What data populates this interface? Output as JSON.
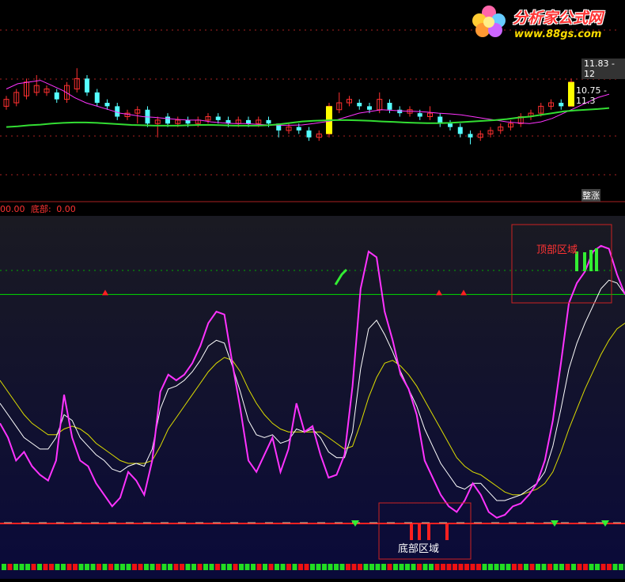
{
  "brand": {
    "name": "分析家公式网",
    "url": "www.88gs.com"
  },
  "price_panel": {
    "price_labels": [
      "11.83 - 12",
      "10.75 - 11.3"
    ],
    "tag": "整涨"
  },
  "status": {
    "left_value": "00.00",
    "bottom_label": "底部:",
    "bottom_value": "0.00"
  },
  "regions": {
    "top": "顶部区域",
    "bottom": "底部区域"
  },
  "colors": {
    "background": "#000000",
    "indicator_background": "#0a0a24",
    "up": "#ff3030",
    "down": "#55ffff",
    "ma_short": "#ff33ff",
    "ma_long": "#33dd33",
    "main_line": "#ff33ff",
    "white_line": "#ffffff",
    "yellow_line": "#dddd00",
    "threshold": "#00dd00",
    "bottom_line": "#ff2020",
    "highlight_bar": "#ffff00"
  },
  "chart_data": [
    {
      "type": "candlestick",
      "title": "",
      "candles": [
        {
          "o": 11.5,
          "c": 11.7,
          "h": 11.8,
          "l": 11.4,
          "up": true
        },
        {
          "o": 11.6,
          "c": 11.9,
          "h": 12.0,
          "l": 11.5,
          "up": true
        },
        {
          "o": 11.8,
          "c": 12.2,
          "h": 12.3,
          "l": 11.7,
          "up": true
        },
        {
          "o": 12.1,
          "c": 11.9,
          "h": 12.4,
          "l": 11.8,
          "up": true
        },
        {
          "o": 11.9,
          "c": 12.0,
          "h": 12.1,
          "l": 11.8,
          "up": true
        },
        {
          "o": 11.9,
          "c": 11.7,
          "h": 12.0,
          "l": 11.6,
          "up": false
        },
        {
          "o": 11.7,
          "c": 12.1,
          "h": 12.2,
          "l": 11.6,
          "up": true
        },
        {
          "o": 12.0,
          "c": 12.3,
          "h": 12.6,
          "l": 11.9,
          "up": true
        },
        {
          "o": 12.3,
          "c": 11.9,
          "h": 12.4,
          "l": 11.8,
          "up": false
        },
        {
          "o": 11.9,
          "c": 11.6,
          "h": 12.0,
          "l": 11.5,
          "up": false
        },
        {
          "o": 11.6,
          "c": 11.5,
          "h": 11.7,
          "l": 11.4,
          "up": false
        },
        {
          "o": 11.5,
          "c": 11.2,
          "h": 11.6,
          "l": 11.1,
          "up": false
        },
        {
          "o": 11.2,
          "c": 11.3,
          "h": 11.4,
          "l": 11.1,
          "up": true
        },
        {
          "o": 11.3,
          "c": 11.4,
          "h": 11.5,
          "l": 11.0,
          "up": true
        },
        {
          "o": 11.4,
          "c": 11.0,
          "h": 11.5,
          "l": 10.9,
          "up": false
        },
        {
          "o": 11.0,
          "c": 11.1,
          "h": 11.2,
          "l": 10.6,
          "up": true
        },
        {
          "o": 11.2,
          "c": 11.0,
          "h": 11.3,
          "l": 10.9,
          "up": false
        },
        {
          "o": 11.0,
          "c": 11.1,
          "h": 11.2,
          "l": 10.9,
          "up": true
        },
        {
          "o": 11.1,
          "c": 11.0,
          "h": 11.2,
          "l": 10.9,
          "up": false
        },
        {
          "o": 11.0,
          "c": 11.1,
          "h": 11.2,
          "l": 10.9,
          "up": true
        },
        {
          "o": 11.1,
          "c": 11.2,
          "h": 11.3,
          "l": 11.0,
          "up": true
        },
        {
          "o": 11.2,
          "c": 11.1,
          "h": 11.3,
          "l": 11.0,
          "up": false
        },
        {
          "o": 11.1,
          "c": 11.0,
          "h": 11.2,
          "l": 10.9,
          "up": false
        },
        {
          "o": 11.0,
          "c": 11.1,
          "h": 11.2,
          "l": 10.9,
          "up": true
        },
        {
          "o": 11.1,
          "c": 11.0,
          "h": 11.2,
          "l": 10.9,
          "up": false
        },
        {
          "o": 11.0,
          "c": 11.1,
          "h": 11.2,
          "l": 10.9,
          "up": true
        },
        {
          "o": 11.1,
          "c": 11.0,
          "h": 11.2,
          "l": 10.9,
          "up": false
        },
        {
          "o": 11.0,
          "c": 10.8,
          "h": 11.0,
          "l": 10.6,
          "up": false
        },
        {
          "o": 10.8,
          "c": 10.9,
          "h": 11.0,
          "l": 10.7,
          "up": true
        },
        {
          "o": 10.9,
          "c": 10.8,
          "h": 11.0,
          "l": 10.7,
          "up": false
        },
        {
          "o": 10.8,
          "c": 10.6,
          "h": 10.9,
          "l": 10.5,
          "up": false
        },
        {
          "o": 10.6,
          "c": 10.7,
          "h": 10.8,
          "l": 10.5,
          "up": true
        },
        {
          "o": 10.7,
          "c": 11.5,
          "h": 11.6,
          "l": 10.6,
          "up": true
        },
        {
          "o": 11.4,
          "c": 11.6,
          "h": 11.9,
          "l": 11.3,
          "up": true
        },
        {
          "o": 11.6,
          "c": 11.7,
          "h": 11.8,
          "l": 11.5,
          "up": true
        },
        {
          "o": 11.6,
          "c": 11.5,
          "h": 11.7,
          "l": 11.4,
          "up": false
        },
        {
          "o": 11.5,
          "c": 11.4,
          "h": 11.6,
          "l": 11.3,
          "up": false
        },
        {
          "o": 11.4,
          "c": 11.7,
          "h": 11.9,
          "l": 11.3,
          "up": true
        },
        {
          "o": 11.6,
          "c": 11.4,
          "h": 11.7,
          "l": 11.3,
          "up": false
        },
        {
          "o": 11.4,
          "c": 11.3,
          "h": 11.5,
          "l": 11.2,
          "up": false
        },
        {
          "o": 11.3,
          "c": 11.4,
          "h": 11.5,
          "l": 11.2,
          "up": true
        },
        {
          "o": 11.3,
          "c": 11.2,
          "h": 11.4,
          "l": 11.1,
          "up": false
        },
        {
          "o": 11.2,
          "c": 11.3,
          "h": 11.5,
          "l": 11.1,
          "up": true
        },
        {
          "o": 11.2,
          "c": 11.0,
          "h": 11.3,
          "l": 10.9,
          "up": false
        },
        {
          "o": 11.0,
          "c": 10.9,
          "h": 11.1,
          "l": 10.8,
          "up": false
        },
        {
          "o": 10.9,
          "c": 10.7,
          "h": 11.0,
          "l": 10.6,
          "up": false
        },
        {
          "o": 10.7,
          "c": 10.6,
          "h": 10.8,
          "l": 10.4,
          "up": false
        },
        {
          "o": 10.6,
          "c": 10.7,
          "h": 10.8,
          "l": 10.5,
          "up": true
        },
        {
          "o": 10.7,
          "c": 10.8,
          "h": 10.9,
          "l": 10.6,
          "up": true
        },
        {
          "o": 10.8,
          "c": 10.9,
          "h": 11.0,
          "l": 10.7,
          "up": true
        },
        {
          "o": 10.9,
          "c": 11.0,
          "h": 11.1,
          "l": 10.8,
          "up": true
        },
        {
          "o": 11.0,
          "c": 11.2,
          "h": 11.3,
          "l": 10.9,
          "up": true
        },
        {
          "o": 11.2,
          "c": 11.3,
          "h": 11.4,
          "l": 11.1,
          "up": true
        },
        {
          "o": 11.3,
          "c": 11.5,
          "h": 11.6,
          "l": 11.2,
          "up": true
        },
        {
          "o": 11.5,
          "c": 11.6,
          "h": 11.7,
          "l": 11.4,
          "up": true
        },
        {
          "o": 11.6,
          "c": 11.5,
          "h": 11.7,
          "l": 11.4,
          "up": false
        },
        {
          "o": 11.5,
          "c": 12.2,
          "h": 12.3,
          "l": 11.5,
          "up": true
        }
      ],
      "ma_short": [
        12.0,
        12.15,
        12.2,
        12.25,
        12.1,
        11.95,
        11.75,
        11.6,
        11.5,
        11.4,
        11.3,
        11.25,
        11.2,
        11.18,
        11.15,
        11.12,
        11.1,
        11.1,
        11.05,
        11.02,
        11.0,
        11.0,
        10.98,
        10.96,
        10.95,
        10.95,
        10.96,
        11.0,
        11.05,
        11.1,
        11.2,
        11.3,
        11.35,
        11.4,
        11.38,
        11.36,
        11.35,
        11.33,
        11.3,
        11.28,
        11.25,
        11.2,
        11.15,
        11.1,
        11.05,
        11.02,
        11.0,
        11.05,
        11.15,
        11.3,
        11.45,
        11.6,
        11.75,
        11.85
      ],
      "ma_long": [
        10.9,
        10.92,
        10.95,
        10.97,
        11.0,
        11.02,
        11.03,
        11.03,
        11.02,
        11.0,
        10.98,
        10.96,
        10.95,
        10.94,
        10.94,
        10.94,
        10.95,
        10.96,
        10.96,
        10.95,
        10.94,
        10.94,
        10.94,
        10.95,
        10.98,
        11.02,
        11.06,
        11.08,
        11.09,
        11.1,
        11.1,
        11.09,
        11.08,
        11.06,
        11.05,
        11.03,
        11.02,
        11.01,
        11.01,
        11.02,
        11.04,
        11.06,
        11.08,
        11.1,
        11.13,
        11.17,
        11.2,
        11.25,
        11.3,
        11.35,
        11.38,
        11.4,
        11.42,
        11.45
      ]
    },
    {
      "type": "line",
      "title": "",
      "ylim": [
        0,
        100
      ],
      "threshold": 80,
      "series": [
        {
          "values": [
            35,
            30,
            22,
            25,
            20,
            17,
            15,
            22,
            45,
            30,
            22,
            20,
            14,
            10,
            6,
            9,
            18,
            15,
            10,
            22,
            46,
            52,
            50,
            52,
            56,
            62,
            70,
            74,
            73,
            56,
            40,
            22,
            18,
            24,
            30,
            18,
            26,
            42,
            32,
            34,
            24,
            16,
            17,
            24,
            48,
            82,
            95,
            93,
            74,
            64,
            52,
            47,
            38,
            22,
            16,
            10,
            6,
            4,
            8,
            14,
            10,
            4,
            2,
            3,
            6,
            7,
            10,
            14,
            22,
            36,
            56,
            77,
            84,
            88,
            95,
            97,
            96,
            87,
            80
          ],
          "color": "#ff33ff"
        },
        {
          "values": [
            42,
            38,
            34,
            30,
            28,
            26,
            26,
            30,
            38,
            36,
            30,
            27,
            24,
            22,
            19,
            18,
            20,
            21,
            20,
            26,
            40,
            47,
            48,
            50,
            53,
            57,
            62,
            64,
            63,
            55,
            46,
            36,
            31,
            30,
            31,
            28,
            29,
            33,
            32,
            33,
            30,
            25,
            23,
            23,
            32,
            54,
            68,
            71,
            66,
            60,
            53,
            47,
            41,
            33,
            27,
            21,
            17,
            13,
            12,
            14,
            14,
            11,
            8,
            8,
            9,
            10,
            12,
            14,
            18,
            27,
            40,
            54,
            63,
            70,
            76,
            82,
            85,
            84,
            80
          ],
          "color": "#ffffff"
        },
        {
          "values": [
            50,
            46,
            42,
            38,
            35,
            33,
            31,
            31,
            33,
            34,
            33,
            31,
            28,
            26,
            24,
            22,
            21,
            21,
            21,
            22,
            27,
            33,
            37,
            41,
            45,
            49,
            53,
            56,
            58,
            57,
            53,
            47,
            42,
            38,
            35,
            33,
            32,
            32,
            32,
            32,
            32,
            30,
            28,
            26,
            27,
            35,
            44,
            51,
            56,
            57,
            55,
            52,
            48,
            43,
            38,
            33,
            28,
            23,
            20,
            18,
            17,
            15,
            13,
            11,
            10,
            10,
            11,
            12,
            14,
            18,
            25,
            33,
            40,
            47,
            53,
            59,
            64,
            68,
            70
          ],
          "color": "#dddd00"
        }
      ]
    }
  ]
}
